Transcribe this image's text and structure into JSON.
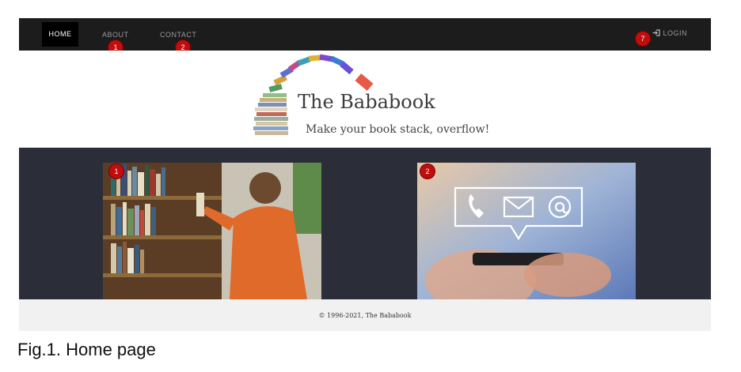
{
  "nav": {
    "home": "HOME",
    "about": "ABOUT",
    "contact": "CONTACT",
    "login": "LOGIN",
    "login_icon": "sign-in-icon"
  },
  "badges": {
    "about": "1",
    "contact": "2",
    "login": "7",
    "card1": "1",
    "card2": "2"
  },
  "brand": {
    "title": "The Bababook",
    "tagline": "Make your book stack, overflow!",
    "logo_icon": "flying-books-logo"
  },
  "cards": [
    {
      "name": "library-photo",
      "icon": "person-at-bookshelf"
    },
    {
      "name": "contact-photo",
      "icon": "phone-mail-at-icons"
    }
  ],
  "footer": {
    "copyright": "© 1996-2021, The Bababook"
  },
  "caption": "Fig.1. Home page",
  "colors": {
    "navbar": "#1c1c1c",
    "hero": "#2b2e39",
    "footer": "#f1f1f1",
    "badge": "#c00d0d"
  }
}
